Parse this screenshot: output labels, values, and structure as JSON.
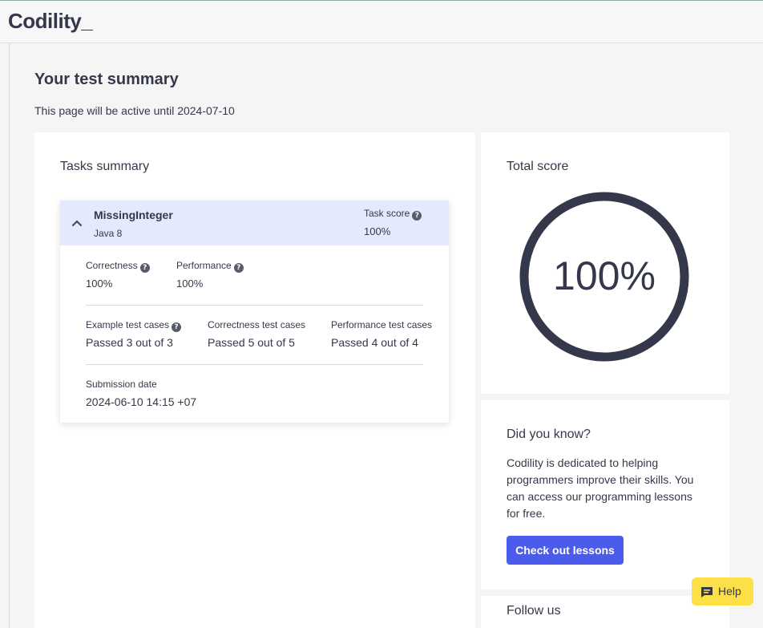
{
  "header": {
    "logo": "Codility",
    "logo_cursor": "_"
  },
  "page": {
    "title": "Your test summary",
    "subtitle": "This page will be active until 2024-07-10"
  },
  "tasks": {
    "title": "Tasks summary",
    "task": {
      "name": "MissingInteger",
      "language": "Java 8",
      "score_label": "Task score",
      "score_value": "100%",
      "correctness_label": "Correctness",
      "correctness_value": "100%",
      "performance_label": "Performance",
      "performance_value": "100%",
      "example_label": "Example test cases",
      "example_value": "Passed 3 out of 3",
      "correctness_cases_label": "Correctness test cases",
      "correctness_cases_value": "Passed 5 out of 5",
      "performance_cases_label": "Performance test cases",
      "performance_cases_value": "Passed 4 out of 4",
      "submission_label": "Submission date",
      "submission_value": "2024-06-10 14:15 +07"
    }
  },
  "score": {
    "title": "Total score",
    "value": "100%",
    "fraction": 1.0
  },
  "know": {
    "title": "Did you know?",
    "text": "Codility is dedicated to helping programmers improve their skills. You can access our programming lessons for free.",
    "button": "Check out lessons"
  },
  "follow": {
    "title": "Follow us"
  },
  "help": {
    "label": "Help"
  },
  "colors": {
    "accent": "#4b5cec",
    "ring": "#35384a",
    "help": "#fde047",
    "task_header": "#e4e9fd"
  }
}
